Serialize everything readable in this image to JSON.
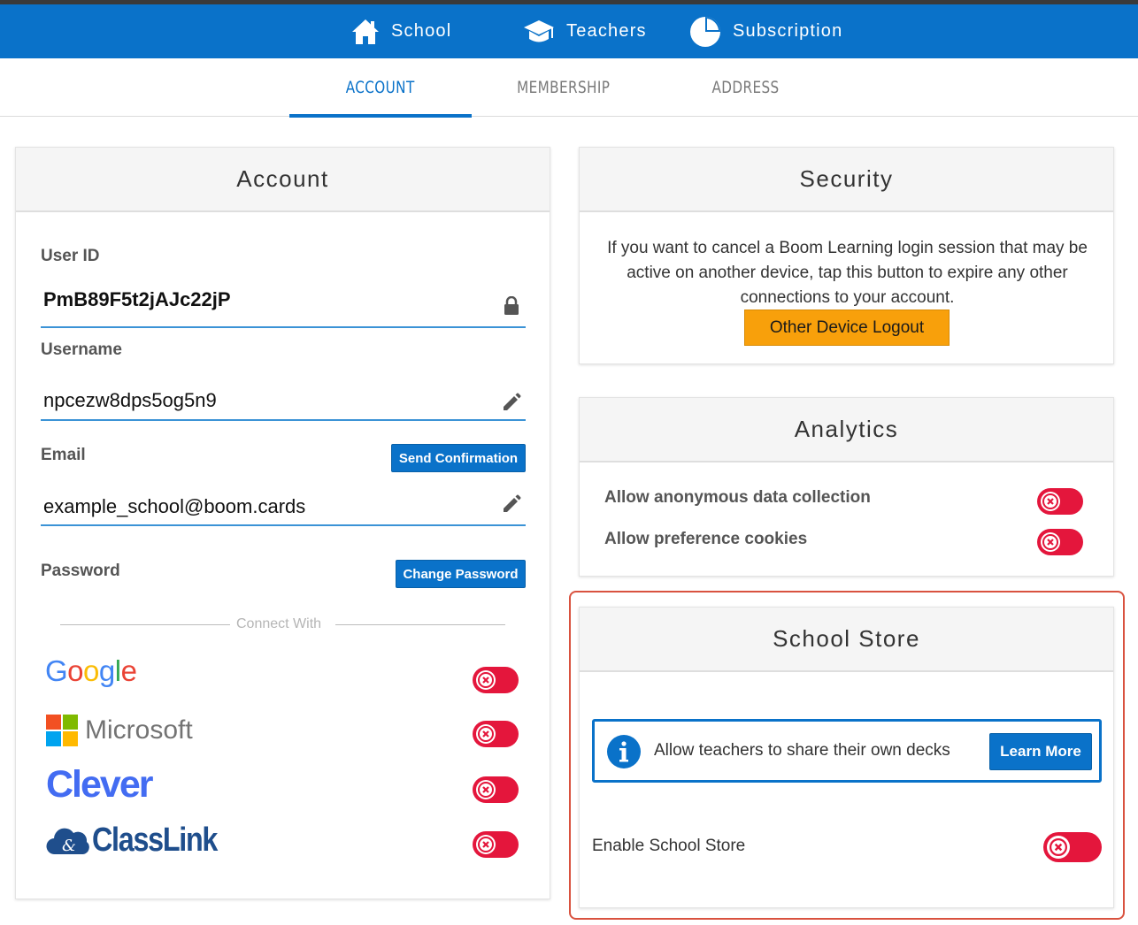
{
  "topnav": {
    "school": "School",
    "teachers": "Teachers",
    "subscription": "Subscription"
  },
  "tabs": {
    "account": "ACCOUNT",
    "membership": "MEMBERSHIP",
    "address": "ADDRESS",
    "active": "account"
  },
  "account": {
    "title": "Account",
    "user_id_label": "User ID",
    "user_id_value": "PmB89F5t2jAJc22jP",
    "username_label": "Username",
    "username_value": "npcezw8dps5og5n9",
    "email_label": "Email",
    "email_value": "example_school@boom.cards",
    "send_confirmation": "Send Confirmation",
    "password_label": "Password",
    "change_password": "Change Password",
    "connect_with": "Connect With",
    "providers": {
      "google": {
        "name": "Google",
        "enabled": false
      },
      "microsoft": {
        "name": "Microsoft",
        "enabled": false
      },
      "clever": {
        "name": "Clever",
        "enabled": false
      },
      "classlink": {
        "name": "ClassLink",
        "enabled": false
      }
    }
  },
  "security": {
    "title": "Security",
    "description": "If you want to cancel a Boom Learning login session that may be active on another device, tap this button to expire any other connections to your account.",
    "logout_button": "Other Device Logout"
  },
  "analytics": {
    "title": "Analytics",
    "anonymous_label": "Allow anonymous data collection",
    "anonymous_enabled": false,
    "cookies_label": "Allow preference cookies",
    "cookies_enabled": false
  },
  "store": {
    "title": "School Store",
    "info_text": "Allow teachers to share their own decks",
    "learn_more": "Learn More",
    "enable_label": "Enable School Store",
    "enable_enabled": false
  },
  "colors": {
    "brand_blue": "#0a72c9",
    "toggle_off": "#e4163c",
    "orange": "#f8a00b",
    "highlight": "#d9523f"
  }
}
